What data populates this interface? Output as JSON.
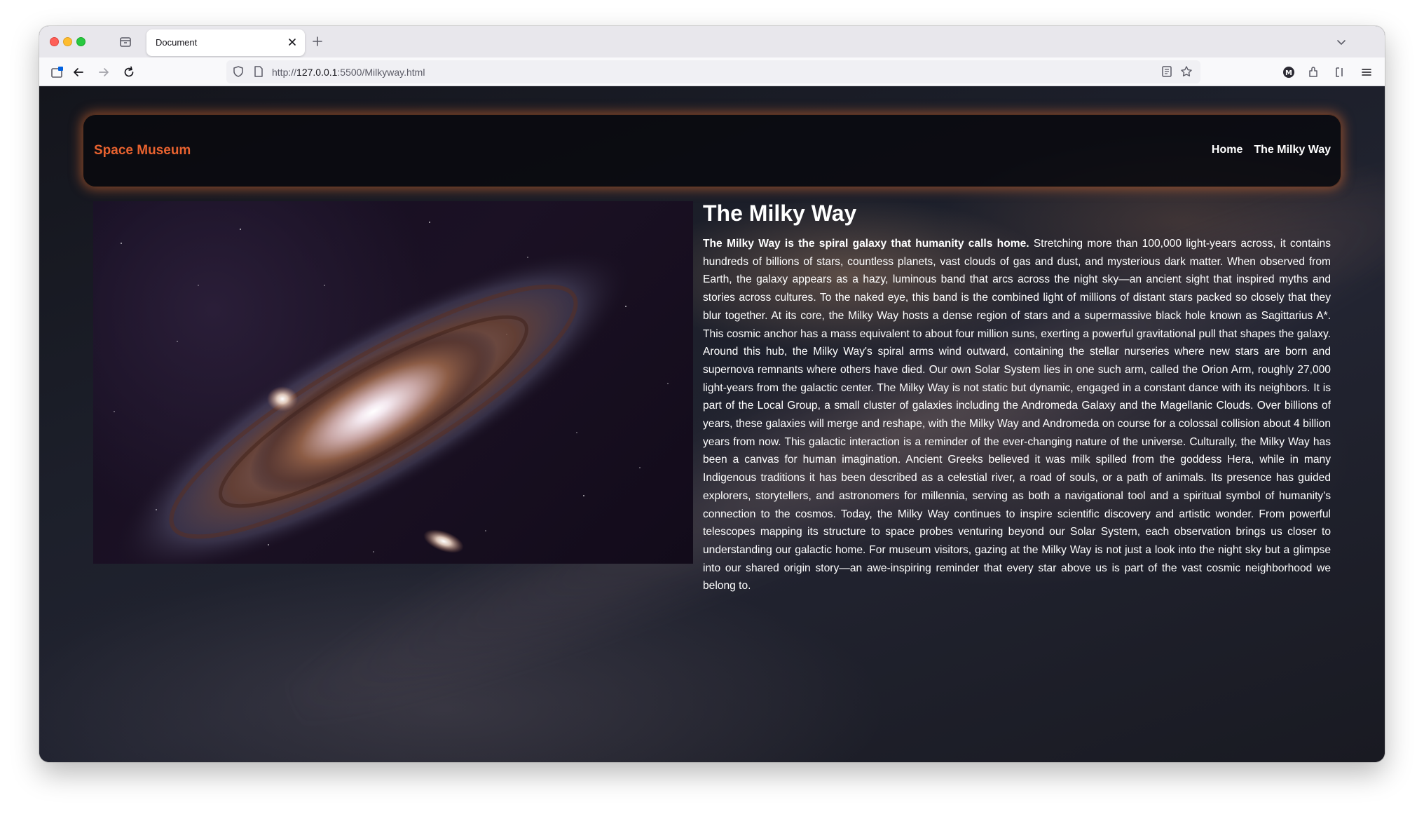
{
  "browser": {
    "tab_title": "Document",
    "url_prefix": "http://",
    "url_host": "127.0.0.1",
    "url_rest": ":5500/Milkyway.html"
  },
  "site": {
    "logo": "Space Museum",
    "nav": [
      "Home",
      "The Milky Way"
    ]
  },
  "article": {
    "title": "The Milky Way",
    "lead": "The Milky Way is the spiral galaxy that humanity calls home.",
    "body": " Stretching more than 100,000 light-years across, it contains hundreds of billions of stars, countless planets, vast clouds of gas and dust, and mysterious dark matter. When observed from Earth, the galaxy appears as a hazy, luminous band that arcs across the night sky—an ancient sight that inspired myths and stories across cultures. To the naked eye, this band is the combined light of millions of distant stars packed so closely that they blur together. At its core, the Milky Way hosts a dense region of stars and a supermassive black hole known as Sagittarius A*. This cosmic anchor has a mass equivalent to about four million suns, exerting a powerful gravitational pull that shapes the galaxy. Around this hub, the Milky Way's spiral arms wind outward, containing the stellar nurseries where new stars are born and supernova remnants where others have died. Our own Solar System lies in one such arm, called the Orion Arm, roughly 27,000 light-years from the galactic center. The Milky Way is not static but dynamic, engaged in a constant dance with its neighbors. It is part of the Local Group, a small cluster of galaxies including the Andromeda Galaxy and the Magellanic Clouds. Over billions of years, these galaxies will merge and reshape, with the Milky Way and Andromeda on course for a colossal collision about 4 billion years from now. This galactic interaction is a reminder of the ever-changing nature of the universe. Culturally, the Milky Way has been a canvas for human imagination. Ancient Greeks believed it was milk spilled from the goddess Hera, while in many Indigenous traditions it has been described as a celestial river, a road of souls, or a path of animals. Its presence has guided explorers, storytellers, and astronomers for millennia, serving as both a navigational tool and a spiritual symbol of humanity's connection to the cosmos. Today, the Milky Way continues to inspire scientific discovery and artistic wonder. From powerful telescopes mapping its structure to space probes venturing beyond our Solar System, each observation brings us closer to understanding our galactic home. For museum visitors, gazing at the Milky Way is not just a look into the night sky but a glimpse into our shared origin story—an awe-inspiring reminder that every star above us is part of the vast cosmic neighborhood we belong to."
  },
  "colors": {
    "accent": "#e8622f",
    "header_glow": "#e06e32"
  }
}
